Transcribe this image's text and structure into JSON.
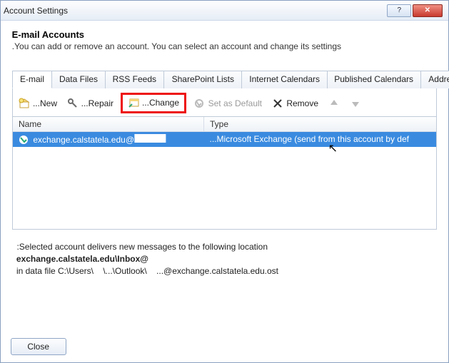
{
  "window": {
    "title": "Account Settings"
  },
  "header": {
    "title": "E-mail Accounts",
    "subtitle": "You can add or remove an account. You can select an account and change its settings."
  },
  "tabs": [
    {
      "label": "E-mail",
      "active": true
    },
    {
      "label": "Data Files"
    },
    {
      "label": "RSS Feeds"
    },
    {
      "label": "SharePoint Lists"
    },
    {
      "label": "Internet Calendars"
    },
    {
      "label": "Published Calendars"
    },
    {
      "label": "Address Books"
    }
  ],
  "toolbar": {
    "new_label": "New...",
    "repair_label": "Repair...",
    "change_label": "Change...",
    "default_label": "Set as Default",
    "remove_label": "Remove"
  },
  "list": {
    "col_name": "Name",
    "col_type": "Type",
    "rows": [
      {
        "name_suffix": "@exchange.calstatela.edu",
        "type": "Microsoft Exchange (send from this account by def..."
      }
    ]
  },
  "info": {
    "line1": "Selected account delivers new messages to the following location:",
    "location_suffix": "@exchange.calstatela.edu\\Inbox",
    "path_prefix": "in data file C:\\Users\\",
    "path_mid": "\\...\\Outlook\\",
    "path_suffix": "...@exchange.calstatela.edu.ost"
  },
  "footer": {
    "close_label": "Close"
  }
}
